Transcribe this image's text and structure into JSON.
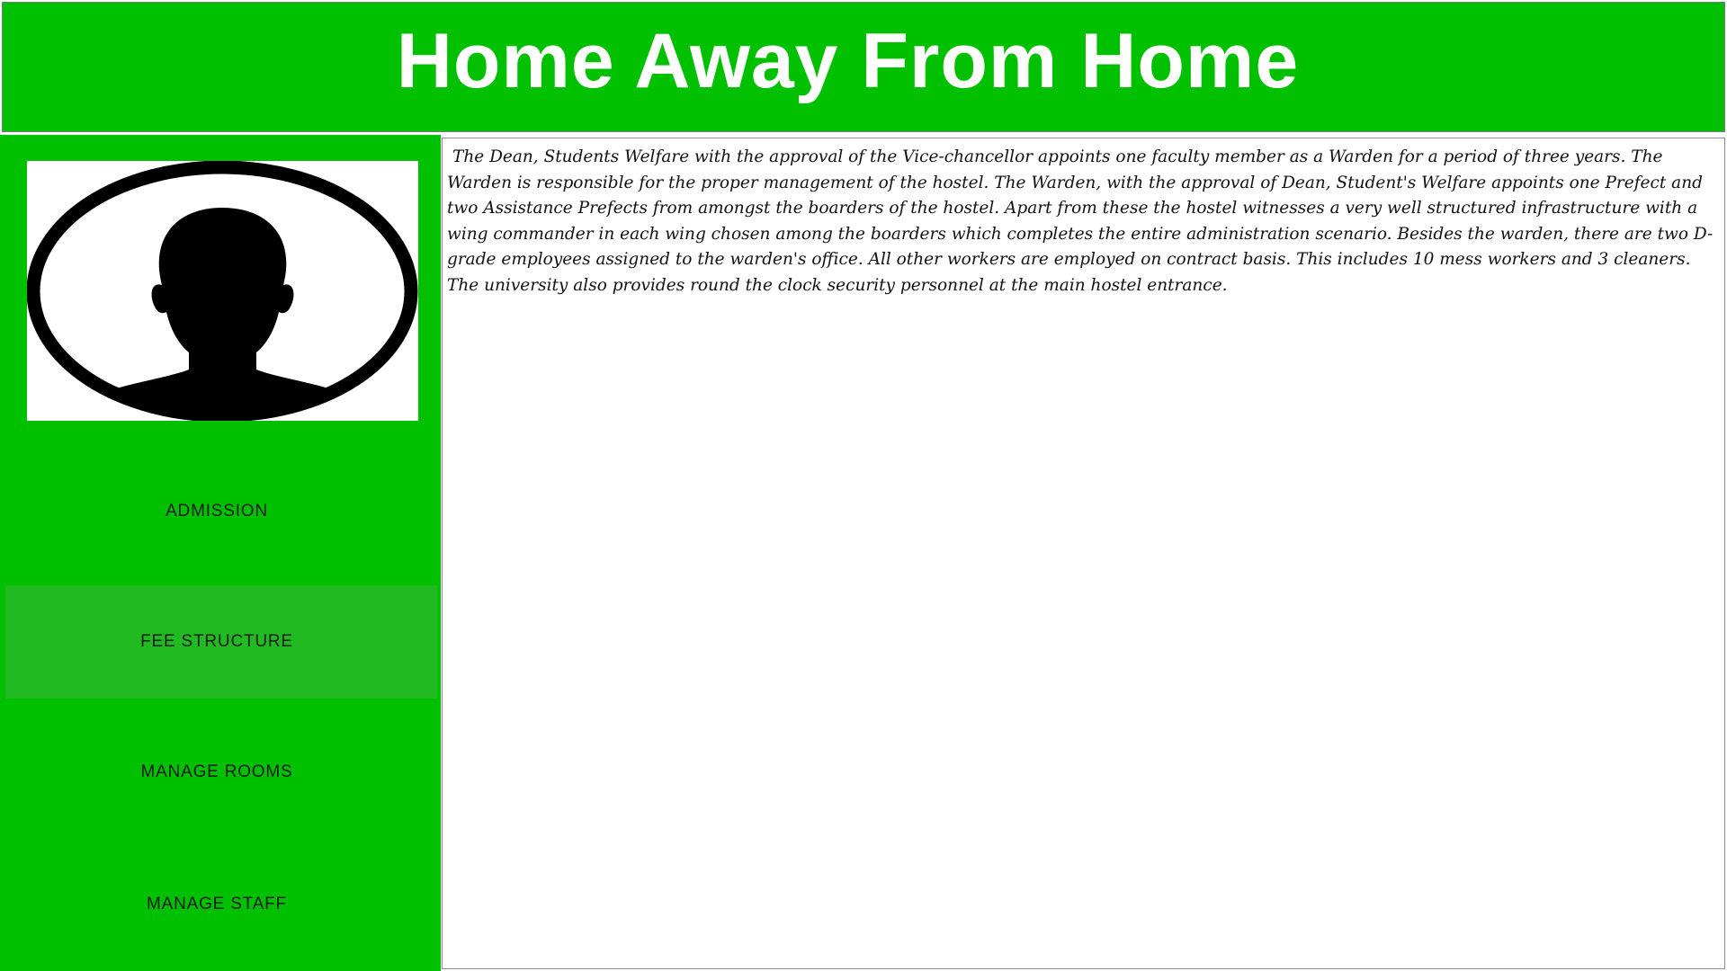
{
  "header": {
    "title": "Home Away From Home"
  },
  "sidebar": {
    "avatar_icon": "user-silhouette-icon",
    "items": [
      {
        "label": "ADMISSION",
        "active": false
      },
      {
        "label": "FEE STRUCTURE",
        "active": true
      },
      {
        "label": "MANAGE ROOMS",
        "active": false
      },
      {
        "label": "MANAGE STAFF",
        "active": false
      }
    ]
  },
  "content": {
    "paragraph": "The Dean, Students Welfare with the approval of the Vice-chancellor appoints one faculty member as a Warden for a period of three years. The Warden is responsible for the proper management of the hostel. The Warden, with the approval of Dean, Student's Welfare appoints one Prefect and two Assistance Prefects from amongst the boarders of the hostel. Apart from these the hostel witnesses a very well structured infrastructure with a wing commander in each wing chosen among the boarders which completes the entire administration scenario. Besides the warden, there are two D-grade employees assigned to the warden's office. All other workers are employed on contract basis. This includes 10 mess workers and 3 cleaners. The university also provides round the clock security personnel at the main hostel entrance."
  },
  "colors": {
    "brand_green": "#00c000",
    "active_item": "#21bb21",
    "header_text": "#ffffff",
    "nav_text": "#1a1a1a"
  }
}
